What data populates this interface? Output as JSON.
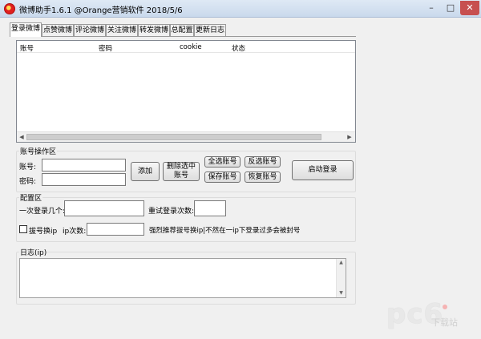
{
  "window": {
    "title": "微博助手1.6.1 @Orange营销软件 2018/5/6"
  },
  "tabs": [
    {
      "label": "登录微博",
      "active": true
    },
    {
      "label": "点赞微博"
    },
    {
      "label": "评论微博"
    },
    {
      "label": "关注微博"
    },
    {
      "label": "转发微博"
    },
    {
      "label": "总配置"
    },
    {
      "label": "更新日志"
    }
  ],
  "accounts_table": {
    "columns": [
      "账号",
      "密码",
      "cookie",
      "状态"
    ],
    "rows": []
  },
  "account_ops": {
    "title": "账号操作区",
    "account_label": "账号:",
    "password_label": "密码:",
    "account_value": "",
    "password_value": "",
    "add": "添加",
    "delete_selected": "删除选中账号",
    "select_all": "全选账号",
    "invert_select": "反选账号",
    "save": "保存账号",
    "restore": "恢复账号",
    "start_login": "启动登录"
  },
  "config": {
    "title": "配置区",
    "batch_label": "一次登录几个:",
    "retry_label": "重试登录次数:",
    "dial_label": "拔号换ip",
    "ip_count_label": "ip次数:",
    "hint": "强烈推荐拔号换ip|不然在一ip下登录过多会被封号",
    "batch_value": "",
    "retry_value": "",
    "ip_count_value": "",
    "dial_checked": false
  },
  "log": {
    "title": "日志(ip)",
    "content": ""
  },
  "watermark": {
    "logo": "pc6",
    "sub": "下载站"
  },
  "colors": {
    "close_button": "#c75050",
    "title_bar": "#dfe9f5"
  }
}
